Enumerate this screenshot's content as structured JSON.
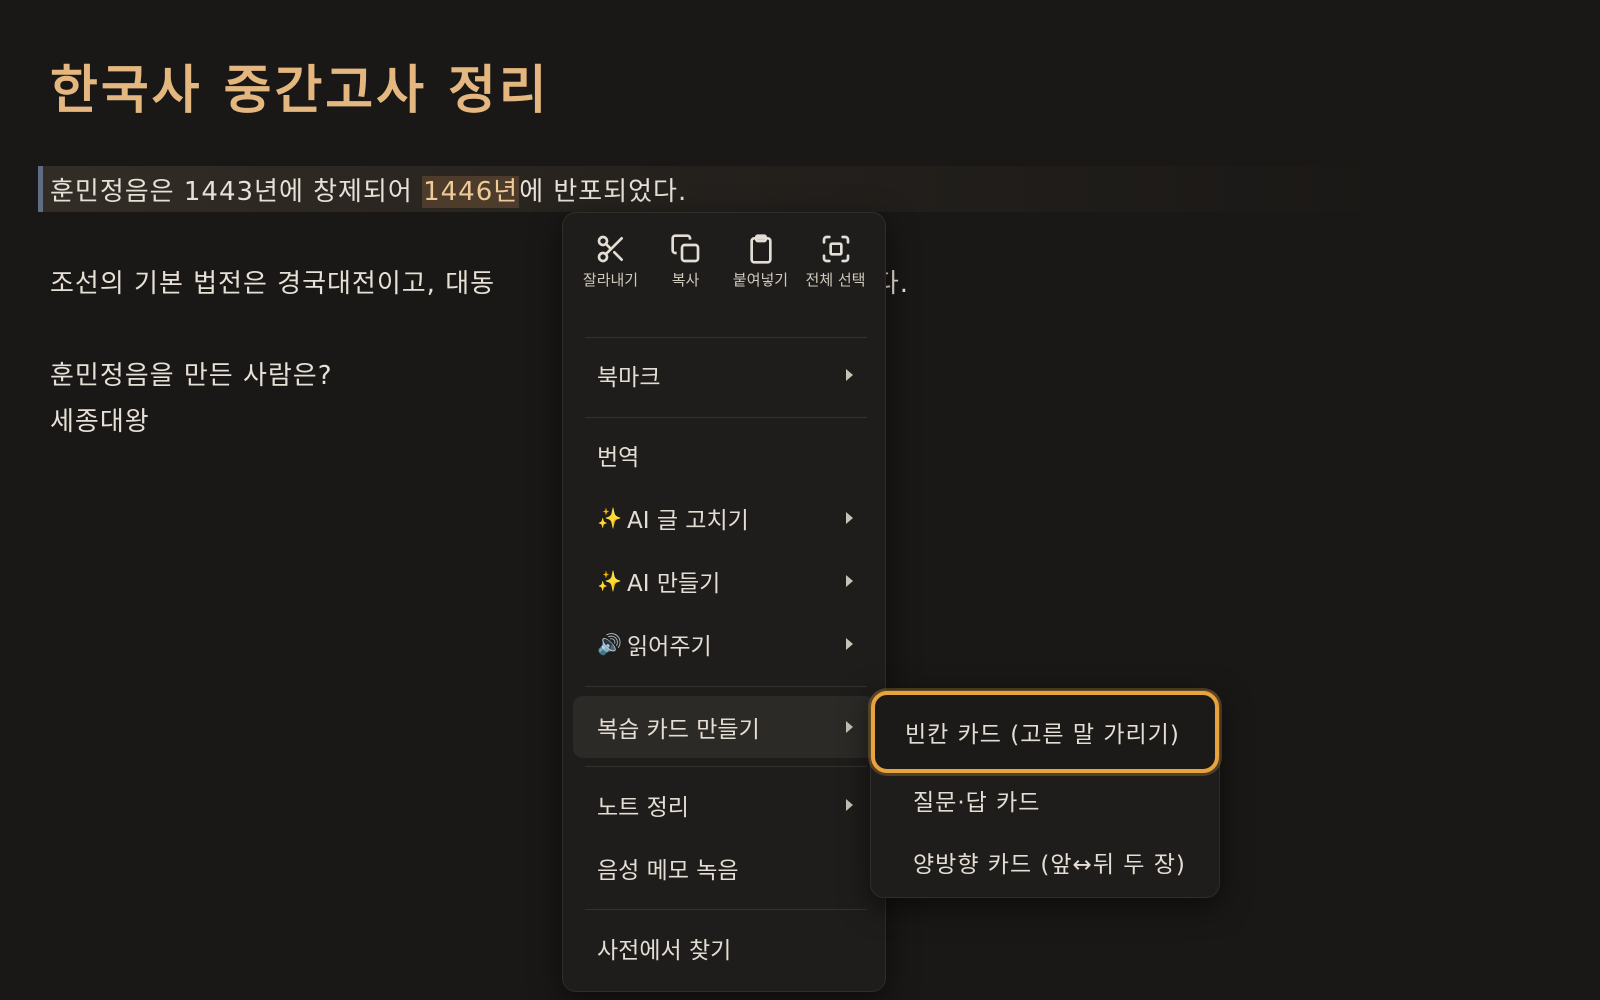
{
  "doc": {
    "title": "한국사 중간고사 정리",
    "line1_before": "훈민정음은 1443년에 창제되어 ",
    "line1_highlight": "1446년",
    "line1_after": "에 반포되었다.",
    "line2_start": "조선의 기본 법전은 경국대전이고, 대동",
    "line2_end": "세도다.",
    "line3": "훈민정음을 만든 사람은?",
    "line4": "세종대왕"
  },
  "menu": {
    "tools": [
      {
        "icon": "scissors-icon",
        "label": "잘라내기"
      },
      {
        "icon": "copy-icon",
        "label": "복사"
      },
      {
        "icon": "clipboard-icon",
        "label": "붙여넣기"
      },
      {
        "icon": "select-all-icon",
        "label": "전체 선택"
      }
    ],
    "items": [
      {
        "label": "북마크",
        "submenu": true
      },
      {
        "label": "번역",
        "submenu": false
      },
      {
        "lead": "✨",
        "label": "AI 글 고치기",
        "submenu": true
      },
      {
        "lead": "✨",
        "label": "AI 만들기",
        "submenu": true
      },
      {
        "lead": "🔊",
        "label": "읽어주기",
        "submenu": true
      },
      {
        "label": "복습 카드 만들기",
        "submenu": true
      },
      {
        "label": "노트 정리",
        "submenu": true
      },
      {
        "label": "음성 메모 녹음",
        "submenu": false
      },
      {
        "label": "사전에서 찾기",
        "submenu": false
      }
    ]
  },
  "submenu": {
    "items": [
      {
        "label": "빈칸 카드 (고른 말 가리기)"
      },
      {
        "label": "질문·답 카드"
      },
      {
        "label": "양방향 카드 (앞↔뒤 두 장)"
      }
    ]
  },
  "colors": {
    "background": "#1a1816",
    "title": "#e3b77f",
    "highlight_bg": "#4d3c2c",
    "focus_ring": "#e8a33d",
    "menu_bg": "#1f1d1b"
  }
}
